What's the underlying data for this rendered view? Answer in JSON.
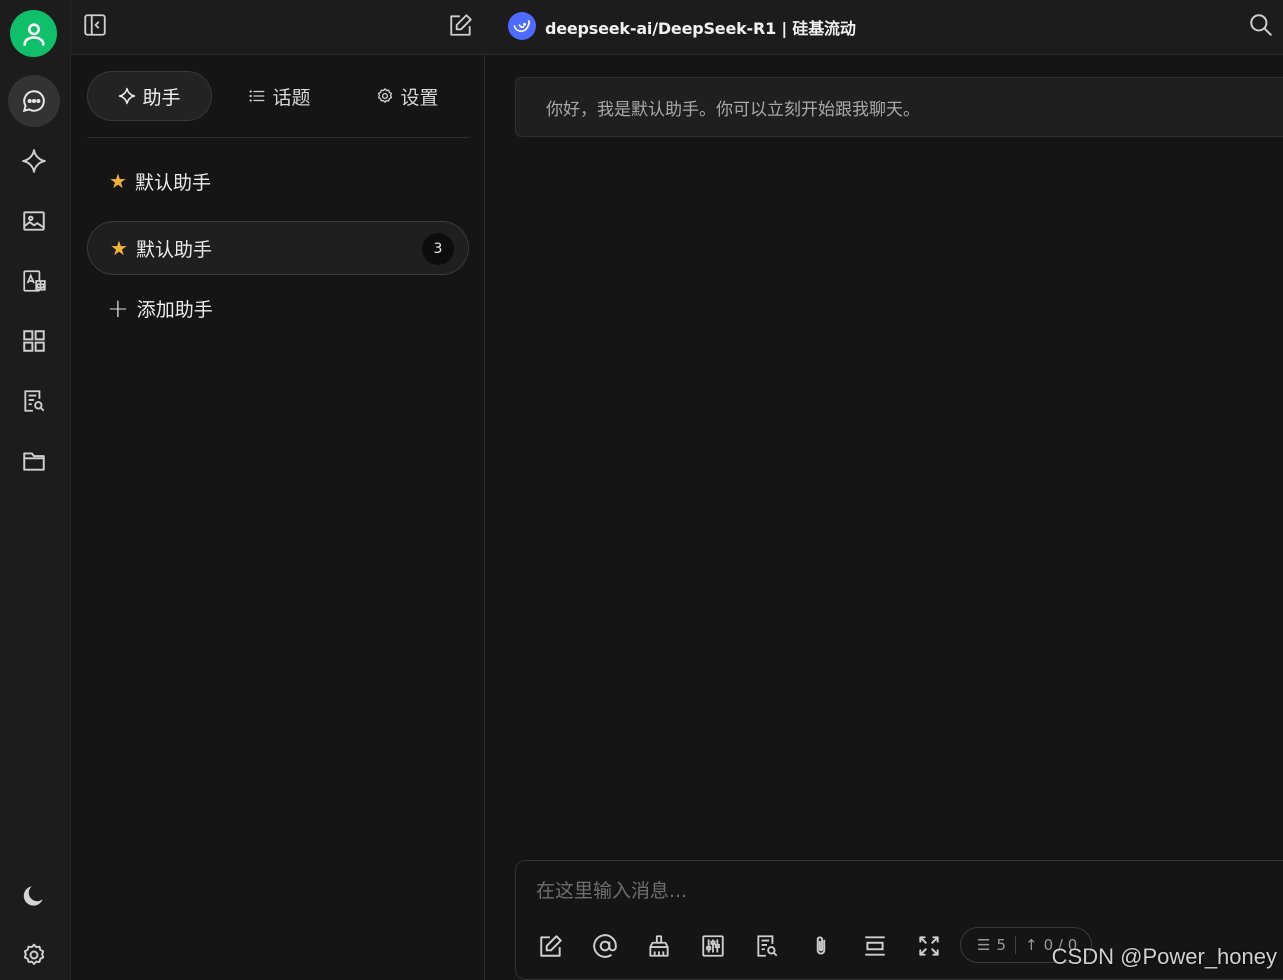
{
  "rail": {
    "items": [
      {
        "name": "chat-icon",
        "active": true
      },
      {
        "name": "sparkle-icon"
      },
      {
        "name": "image-icon"
      },
      {
        "name": "translate-icon"
      },
      {
        "name": "apps-grid-icon"
      },
      {
        "name": "knowledge-search-icon"
      },
      {
        "name": "folder-icon"
      }
    ],
    "bottom": [
      {
        "name": "moon-icon"
      },
      {
        "name": "gear-icon"
      }
    ]
  },
  "topbar": {
    "model_title": "deepseek-ai/DeepSeek-R1 | 硅基流动"
  },
  "panel": {
    "tabs": [
      {
        "label": "助手",
        "icon": "sparkle-icon",
        "active": true
      },
      {
        "label": "话题",
        "icon": "list-icon"
      },
      {
        "label": "设置",
        "icon": "gear-icon"
      }
    ],
    "assistants": [
      {
        "label": "默认助手",
        "active": false
      },
      {
        "label": "默认助手",
        "active": true,
        "count": "3"
      }
    ],
    "add_label": "添加助手"
  },
  "chat": {
    "welcome": "你好，我是默认助手。你可以立刻开始跟我聊天。",
    "input_placeholder": "在这里输入消息...",
    "context_count": "5",
    "token_count": "0 / 0"
  },
  "colors": {
    "accent_green": "#0fbf6a",
    "deepseek_blue": "#4d6bfe",
    "star_gold": "#f2b531"
  },
  "watermark": "CSDN @Power_honey"
}
